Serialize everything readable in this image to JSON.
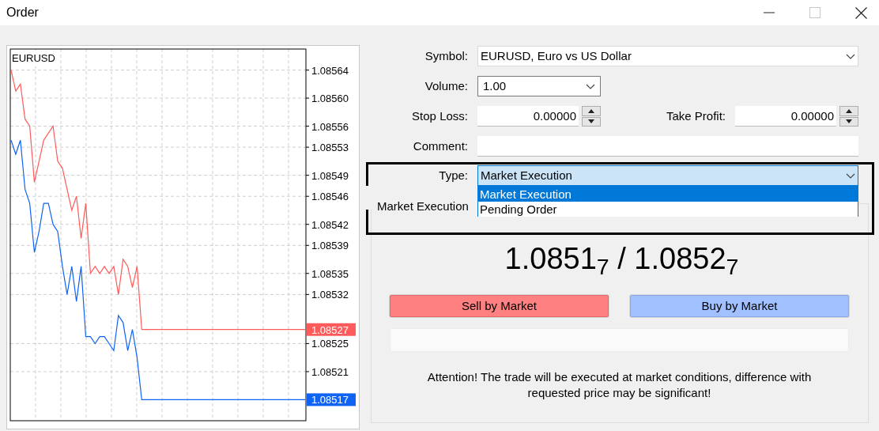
{
  "window": {
    "title": "Order",
    "controls": [
      {
        "kind": "minimize",
        "disabled": false
      },
      {
        "kind": "maximize",
        "disabled": true
      },
      {
        "kind": "close",
        "disabled": false
      }
    ]
  },
  "chart": {
    "symbol": "EURUSD",
    "bid_badge": "1.08517",
    "ask_badge": "1.08527",
    "chart_data": {
      "type": "line",
      "categories": [
        null,
        null,
        null,
        null,
        null,
        null,
        null,
        null,
        null,
        null,
        null,
        null,
        null,
        null,
        null,
        null,
        null,
        null,
        null,
        null,
        null,
        null,
        null,
        null,
        null,
        null,
        null,
        null,
        null,
        null,
        null,
        null,
        null,
        null,
        null,
        null,
        null,
        null,
        null,
        null,
        null,
        null,
        null,
        null,
        null,
        null,
        null,
        null,
        null,
        null,
        null,
        null,
        null,
        null,
        null,
        null,
        null,
        null,
        null,
        null,
        null,
        null,
        null,
        null
      ],
      "series": [
        {
          "color": "#ff5b5b",
          "values": [
            1.08564,
            1.08561,
            1.08562,
            1.08557,
            1.08556,
            1.08548,
            1.08551,
            1.08554,
            1.08555,
            1.08556,
            1.08551,
            1.0855,
            1.08547,
            1.08544,
            1.08546,
            1.0854,
            1.08545,
            1.08535,
            1.08536,
            1.08535,
            1.08536,
            1.08535,
            1.08536,
            1.08532,
            1.08537,
            1.08536,
            1.08533,
            1.08536,
            1.08527,
            1.08527,
            1.08527,
            1.08527,
            1.08527,
            1.08527,
            1.08527,
            1.08527,
            1.08527,
            1.08527,
            1.08527,
            1.08527,
            1.08527,
            1.08527,
            1.08527,
            1.08527,
            1.08527,
            1.08527,
            1.08527,
            1.08527,
            1.08527,
            1.08527,
            1.08527,
            1.08527,
            1.08527,
            1.08527,
            1.08527,
            1.08527,
            1.08527,
            1.08527,
            1.08527,
            1.08527,
            1.08527,
            1.08527,
            1.08527,
            1.08527
          ]
        },
        {
          "color": "#0f64f5",
          "values": [
            1.08554,
            1.08552,
            1.08554,
            1.08547,
            1.08545,
            1.08538,
            1.08541,
            1.08545,
            1.08545,
            1.08542,
            1.08541,
            1.08536,
            1.08532,
            1.08536,
            1.08531,
            1.08536,
            1.08526,
            1.08526,
            1.08525,
            1.08526,
            1.08526,
            1.08525,
            1.08524,
            1.08529,
            1.08528,
            1.08524,
            1.08527,
            1.08523,
            1.08517,
            1.08517,
            1.08517,
            1.08517,
            1.08517,
            1.08517,
            1.08517,
            1.08517,
            1.08517,
            1.08517,
            1.08517,
            1.08517,
            1.08517,
            1.08517,
            1.08517,
            1.08517,
            1.08517,
            1.08517,
            1.08517,
            1.08517,
            1.08517,
            1.08517,
            1.08517,
            1.08517,
            1.08517,
            1.08517,
            1.08517,
            1.08517,
            1.08517,
            1.08517,
            1.08517,
            1.08517,
            1.08517,
            1.08517,
            1.08517,
            1.08517
          ]
        }
      ],
      "grid": true,
      "ylim": [
        1.08514,
        1.08567
      ],
      "yticks": [
        {
          "value": 1.08564,
          "label": "1.08564"
        },
        {
          "value": 1.0856,
          "label": "1.08560"
        },
        {
          "value": 1.08556,
          "label": "1.08556"
        },
        {
          "value": 1.08553,
          "label": "1.08553"
        },
        {
          "value": 1.08549,
          "label": "1.08549"
        },
        {
          "value": 1.08546,
          "label": "1.08546"
        },
        {
          "value": 1.08542,
          "label": "1.08542"
        },
        {
          "value": 1.08539,
          "label": "1.08539"
        },
        {
          "value": 1.08535,
          "label": "1.08535"
        },
        {
          "value": 1.08532,
          "label": "1.08532"
        },
        {
          "value": 1.08525,
          "label": "1.08525"
        },
        {
          "value": 1.08521,
          "label": "1.08521"
        }
      ]
    }
  },
  "form": {
    "symbol": {
      "label": "Symbol:",
      "value": "EURUSD, Euro vs US Dollar"
    },
    "volume": {
      "label": "Volume:",
      "value": "1.00"
    },
    "stop_loss": {
      "label": "Stop Loss:",
      "value": "0.00000"
    },
    "take_profit": {
      "label": "Take Profit:",
      "value": "0.00000"
    },
    "comment": {
      "label": "Comment:"
    },
    "type": {
      "label": "Type:",
      "value": "Market Execution",
      "expanded": true,
      "options": [
        {
          "label": "Market Execution",
          "selected": true
        },
        {
          "label": "Pending Order",
          "selected": false
        }
      ]
    }
  },
  "execution": {
    "group_label": "Market Execution",
    "price": "1.0851$_{7}$ / 1.0852$_{7}$",
    "sell_button": "Sell by Market",
    "buy_button": "Buy by Market",
    "notice": "Attention! The trade will be executed at market conditions, difference with requested price may be significant!"
  }
}
